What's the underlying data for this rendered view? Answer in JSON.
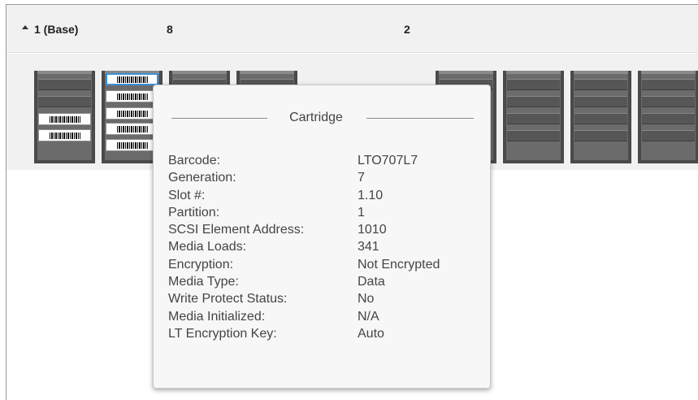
{
  "frame": {
    "title": "1 (Base)",
    "count_a": "8",
    "count_b": "2"
  },
  "magazines": [
    {
      "slots": [
        "empty",
        "empty",
        "cartridge",
        "cartridge"
      ]
    },
    {
      "slots": [
        "cartridge-selected",
        "cartridge",
        "cartridge",
        "cartridge",
        "cartridge"
      ]
    },
    {
      "slots": [
        "empty",
        "empty",
        "empty",
        "empty"
      ]
    },
    {
      "slots": [
        "empty",
        "empty",
        "empty",
        "empty"
      ]
    },
    {
      "slots": [
        "empty",
        "empty",
        "empty",
        "empty"
      ]
    },
    {
      "slots": [
        "empty",
        "empty",
        "empty",
        "empty"
      ]
    },
    {
      "slots": [
        "empty",
        "empty",
        "empty",
        "empty"
      ]
    },
    {
      "slots": [
        "empty",
        "empty",
        "empty",
        "empty"
      ]
    }
  ],
  "tooltip": {
    "title": "Cartridge",
    "rows": [
      {
        "label": "Barcode:",
        "value": "LTO707L7"
      },
      {
        "label": "Generation:",
        "value": "7"
      },
      {
        "label": "Slot #:",
        "value": "1.10"
      },
      {
        "label": "Partition:",
        "value": "1"
      },
      {
        "label": "SCSI Element Address:",
        "value": "1010"
      },
      {
        "label": "Media Loads:",
        "value": "341"
      },
      {
        "label": "Encryption:",
        "value": "Not Encrypted"
      },
      {
        "label": "Media Type:",
        "value": "Data"
      },
      {
        "label": "Write Protect Status:",
        "value": "No"
      },
      {
        "label": "Media Initialized:",
        "value": "N/A"
      },
      {
        "label": "LT Encryption Key:",
        "value": "Auto"
      }
    ]
  },
  "icons": {
    "collapse": "collapse-arrow-up-icon"
  },
  "colors": {
    "header_bg": "#f1f1f1",
    "magazine": "#6b6b6b",
    "selected_border": "#3c8fd6",
    "tooltip_bg": "#f7f7f7"
  }
}
